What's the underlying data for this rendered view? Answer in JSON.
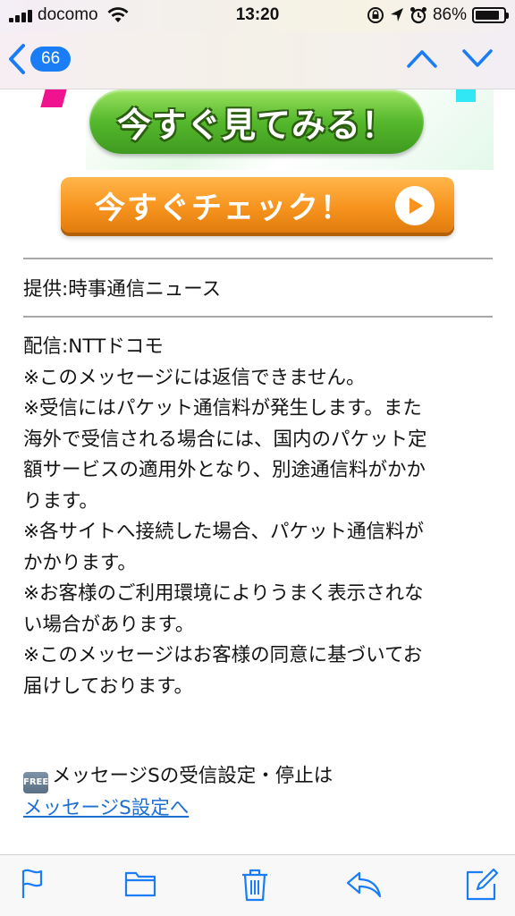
{
  "status_bar": {
    "carrier": "docomo",
    "time": "13:20",
    "battery_percent": "86%",
    "battery_level": 0.86,
    "signal_bars": 4,
    "icons": [
      "signal-icon",
      "wifi-icon",
      "orientation-lock-icon",
      "location-icon",
      "alarm-icon",
      "battery-icon"
    ]
  },
  "nav": {
    "back_count": "66",
    "icons": [
      "back-chevron-icon",
      "previous-message-icon",
      "next-message-icon"
    ]
  },
  "banner": {
    "green_button_label": "今すぐ見てみる！",
    "orange_button_label": "今すぐチェック！"
  },
  "body": {
    "provider": "提供:時事通信ニュース",
    "lines": [
      "配信:NTTドコモ",
      "※このメッセージには返信できません。",
      "※受信にはパケット通信料が発生します。また",
      "海外で受信される場合には、国内のパケット定",
      "額サービスの適用外となり、別途通信料がかか",
      "ります。",
      "※各サイトへ接続した場合、パケット通信料が",
      "かかります。",
      "※お客様のご利用環境によりうまく表示されな",
      "い場合があります。",
      "※このメッセージはお客様の同意に基づいてお",
      "届けしております。"
    ],
    "free_icon_label": "FREE",
    "settings_text": "メッセージSの受信設定・停止は",
    "settings_link": "メッセージS設定へ"
  },
  "toolbar": {
    "icons": [
      "flag-icon",
      "folder-icon",
      "trash-icon",
      "reply-icon",
      "compose-icon"
    ]
  },
  "colors": {
    "accent": "#1a7df5",
    "link": "#1e6fd0",
    "green_button": "#55b82c",
    "orange_button": "#f7931e"
  }
}
